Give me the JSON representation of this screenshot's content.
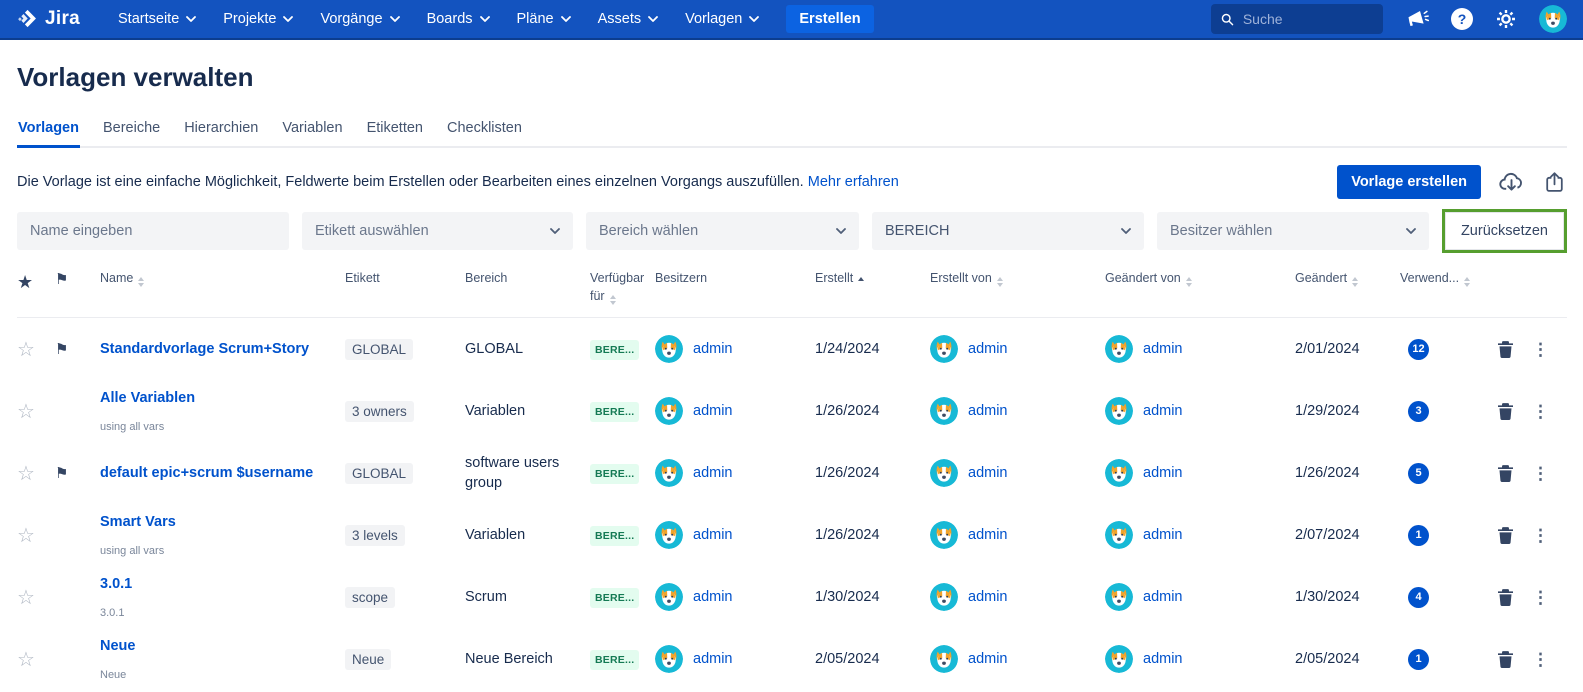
{
  "colors": {
    "nav-bg": "#1353BF",
    "nav-dark": "#0D3E92",
    "nav-border": "#0C3D8F",
    "create-btn": "#0C63E2",
    "link": "#0052CC",
    "text": "#172B4D",
    "header-text": "#44546F",
    "divider": "#EBECF0",
    "filter-bg": "#F3F4F6",
    "tag-bg": "#F2F3F5",
    "tag-text": "#44546F",
    "scope-bg": "#E3FCEF",
    "scope-text": "#147A54",
    "badge-bg": "#0052CC",
    "annotation": "#569E2F",
    "avatar-bg": "#17B9D6"
  },
  "nav": {
    "logo_text": "Jira",
    "items": [
      "Startseite",
      "Projekte",
      "Vorgänge",
      "Boards",
      "Pläne",
      "Assets",
      "Vorlagen"
    ],
    "create_label": "Erstellen",
    "search_placeholder": "Suche"
  },
  "page": {
    "title": "Vorlagen verwalten",
    "tabs": [
      "Vorlagen",
      "Bereiche",
      "Hierarchien",
      "Variablen",
      "Etiketten",
      "Checklisten"
    ],
    "active_tab": "Vorlagen",
    "description": "Die Vorlage ist eine einfache Möglichkeit, Feldwerte beim Erstellen oder Bearbeiten eines einzelnen Vorgangs auszufüllen.",
    "learn_more_label": "Mehr erfahren",
    "create_button_label": "Vorlage erstellen"
  },
  "filters": {
    "name_placeholder": "Name eingeben",
    "etikett_placeholder": "Etikett auswählen",
    "bereich_placeholder": "Bereich wählen",
    "bereich_selected_value": "BEREICH",
    "besitzer_placeholder": "Besitzer wählen",
    "reset_label": "Zurücksetzen"
  },
  "table": {
    "headers": {
      "name": "Name",
      "etikett": "Etikett",
      "bereich": "Bereich",
      "verfuegbar": "Verfügbar für",
      "besitzern": "Besitzern",
      "erstellt": "Erstellt",
      "erstellt_von": "Erstellt von",
      "geaendert_von": "Geändert von",
      "geaendert": "Geändert",
      "verwendungen": "Verwend..."
    },
    "rows": [
      {
        "flagged": true,
        "name": "Standardvorlage Scrum+Story",
        "subtitle": "",
        "etikett": "GLOBAL",
        "bereich": "GLOBAL",
        "verfuegbar": "BERE...",
        "besitzer": "admin",
        "erstellt": "1/24/2024",
        "erstellt_von": "admin",
        "geaendert_von": "admin",
        "geaendert": "2/01/2024",
        "verwendungen": "12"
      },
      {
        "flagged": false,
        "name": "Alle Variablen",
        "subtitle": "using all vars",
        "etikett": "3 owners",
        "bereich": "Variablen",
        "verfuegbar": "BERE...",
        "besitzer": "admin",
        "erstellt": "1/26/2024",
        "erstellt_von": "admin",
        "geaendert_von": "admin",
        "geaendert": "1/29/2024",
        "verwendungen": "3"
      },
      {
        "flagged": true,
        "name": "default epic+scrum $username",
        "subtitle": "",
        "etikett": "GLOBAL",
        "bereich": "software users group",
        "verfuegbar": "BERE...",
        "besitzer": "admin",
        "erstellt": "1/26/2024",
        "erstellt_von": "admin",
        "geaendert_von": "admin",
        "geaendert": "1/26/2024",
        "verwendungen": "5"
      },
      {
        "flagged": false,
        "name": "Smart Vars",
        "subtitle": "using all vars",
        "etikett": "3 levels",
        "bereich": "Variablen",
        "verfuegbar": "BERE...",
        "besitzer": "admin",
        "erstellt": "1/26/2024",
        "erstellt_von": "admin",
        "geaendert_von": "admin",
        "geaendert": "2/07/2024",
        "verwendungen": "1"
      },
      {
        "flagged": false,
        "name": "3.0.1",
        "subtitle": "3.0.1",
        "etikett": "scope",
        "bereich": "Scrum",
        "verfuegbar": "BERE...",
        "besitzer": "admin",
        "erstellt": "1/30/2024",
        "erstellt_von": "admin",
        "geaendert_von": "admin",
        "geaendert": "1/30/2024",
        "verwendungen": "4"
      },
      {
        "flagged": false,
        "name": "Neue",
        "subtitle": "Neue",
        "etikett": "Neue",
        "bereich": "Neue Bereich",
        "verfuegbar": "BERE...",
        "besitzer": "admin",
        "erstellt": "2/05/2024",
        "erstellt_von": "admin",
        "geaendert_von": "admin",
        "geaendert": "2/05/2024",
        "verwendungen": "1"
      }
    ]
  }
}
